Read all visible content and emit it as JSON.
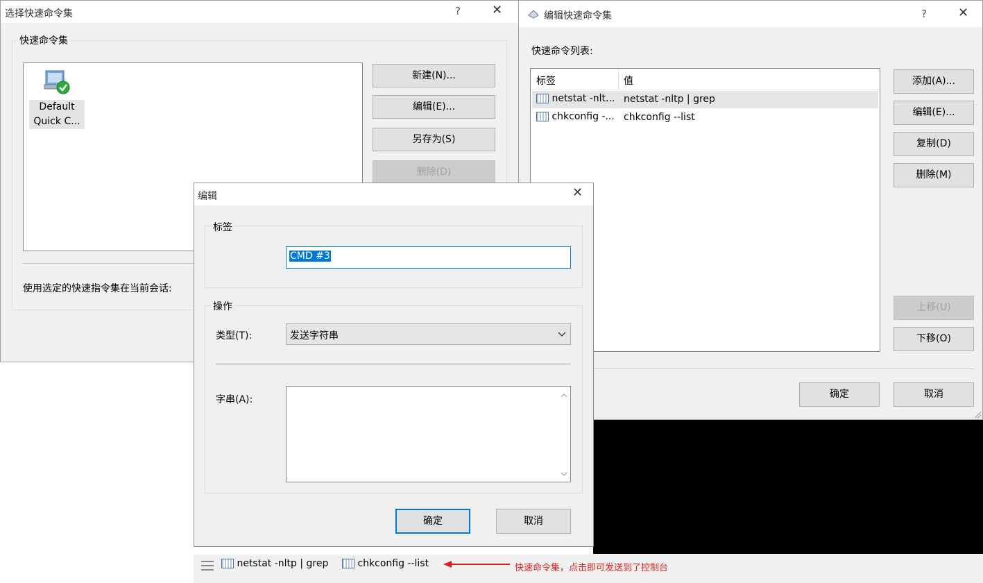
{
  "select_dialog": {
    "title": "选择快速命令集",
    "help": "?",
    "group_label": "快速命令集",
    "item": {
      "line1": "Default",
      "line2": "Quick C..."
    },
    "buttons": {
      "new": "新建(N)...",
      "edit": "编辑(E)...",
      "save_as": "另存为(S)",
      "delete": "删除(D)"
    },
    "apply_text": "使用选定的快速指令集在当前会话:"
  },
  "edit_set_dialog": {
    "title": "编辑快速命令集",
    "help": "?",
    "list_label": "快速命令列表:",
    "columns": {
      "tag": "标签",
      "value": "值"
    },
    "rows": [
      {
        "tag": "netstat -nlt...",
        "value": "netstat -nltp | grep"
      },
      {
        "tag": "chkconfig -...",
        "value": "chkconfig --list"
      }
    ],
    "buttons": {
      "add": "添加(A)...",
      "edit": "编辑(E)...",
      "copy": "复制(D)",
      "delete": "删除(M)",
      "up": "上移(U)",
      "down": "下移(O)",
      "ok": "确定",
      "cancel": "取消"
    }
  },
  "edit_dialog": {
    "title": "编辑",
    "tag_group": "标签",
    "tag_value": "CMD #3",
    "op_group": "操作",
    "type_label": "类型(T):",
    "type_value": "发送字符串",
    "string_label": "字串(A):",
    "string_value": "",
    "ok": "确定",
    "cancel": "取消"
  },
  "quickbar": {
    "items": [
      "netstat -nltp | grep",
      "chkconfig --list"
    ],
    "annotation": "快速命令集，点击即可发送到了控制台"
  },
  "colors": {
    "accent": "#0078d7",
    "annotation_red": "#e02020",
    "terminal_bg": "#000000"
  }
}
